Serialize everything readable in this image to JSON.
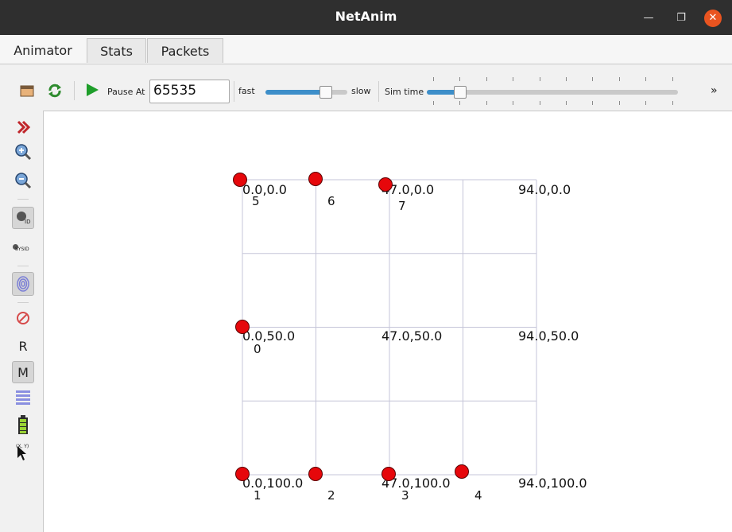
{
  "window": {
    "title": "NetAnim"
  },
  "tabs": [
    {
      "label": "Animator",
      "active": true
    },
    {
      "label": "Stats",
      "active": false
    },
    {
      "label": "Packets",
      "active": false
    }
  ],
  "toolbar": {
    "pause_at_label": "Pause At",
    "pause_at_value": "65535",
    "fast_label": "fast",
    "slow_label": "slow",
    "speed_level": 0.73,
    "sim_time_label": "Sim time",
    "sim_time_level": 0.13,
    "overflow_glyph": "»"
  },
  "sidebar": {
    "r_label": "R",
    "m_label": "M",
    "sysid_label": "SYSID",
    "xy_label": "(X, Y)"
  },
  "colors": {
    "node": "#e6070b",
    "grid": "#c5c5d8",
    "slider_fill": "#3d8ec9",
    "close_button": "#e95420"
  },
  "grid_labels": [
    {
      "text": "0.0,0.0"
    },
    {
      "text": "47.0,0.0"
    },
    {
      "text": "94.0,0.0"
    },
    {
      "text": "0.0,50.0"
    },
    {
      "text": "47.0,50.0"
    },
    {
      "text": "94.0,50.0"
    },
    {
      "text": "0.0,100.0"
    },
    {
      "text": "47.0,100.0"
    },
    {
      "text": "94.0,100.0"
    }
  ],
  "nodes": [
    {
      "id": "0"
    },
    {
      "id": "1"
    },
    {
      "id": "2"
    },
    {
      "id": "3"
    },
    {
      "id": "4"
    },
    {
      "id": "5"
    },
    {
      "id": "6"
    },
    {
      "id": "7"
    }
  ]
}
